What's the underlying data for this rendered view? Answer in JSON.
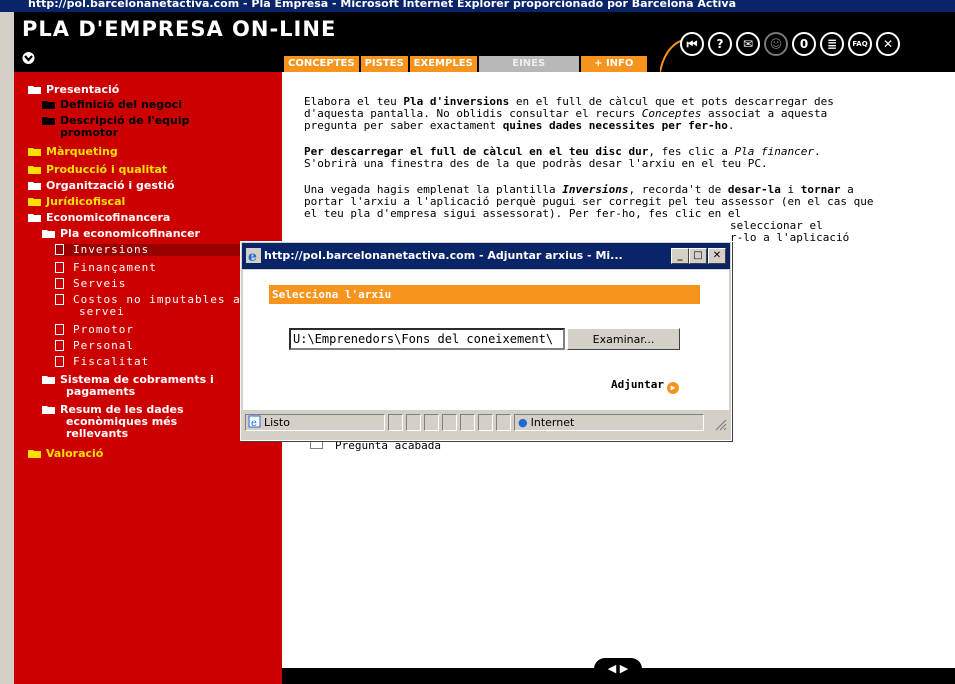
{
  "browser": {
    "title_bar": "http://pol.barcelonanetactiva.com - Pla Empresa - Microsoft Internet Explorer proporcionado por Barcelona Activa"
  },
  "app": {
    "title": "PLA D'EMPRESA ON-LINE"
  },
  "tabs": [
    "CONCEPTES",
    "PISTES",
    "EXEMPLES",
    "EINES",
    "+ INFO"
  ],
  "toolbar_icons": [
    {
      "name": "back-icon",
      "glyph": "⏮"
    },
    {
      "name": "help-icon",
      "glyph": "?"
    },
    {
      "name": "mail-icon",
      "glyph": "✉"
    },
    {
      "name": "user-icon",
      "glyph": "☺"
    },
    {
      "name": "clip-icon",
      "glyph": "0"
    },
    {
      "name": "notes-icon",
      "glyph": "≣"
    },
    {
      "name": "faq-icon",
      "glyph": "FAQ"
    },
    {
      "name": "close-icon",
      "glyph": "✕"
    }
  ],
  "sidebar": {
    "items": [
      {
        "label": "Presentació",
        "color": "#ffffff"
      },
      {
        "label": "Definició del negoci",
        "color": "#000000"
      },
      {
        "label": "Descripció de l'equip",
        "label2": "promotor",
        "color": "#000000"
      },
      {
        "label": "Màrqueting",
        "color": "#ffe000"
      },
      {
        "label": "Producció i qualitat",
        "color": "#ffe000"
      },
      {
        "label": "Organització i gestió",
        "color": "#ffffff"
      },
      {
        "label": "Jurídicofiscal",
        "color": "#ffe000"
      },
      {
        "label": "Economicofinancera",
        "color": "#ffffff"
      },
      {
        "label": "Pla economicofinancer",
        "color": "#ffffff"
      },
      {
        "label": "Inversions"
      },
      {
        "label": "Finançament"
      },
      {
        "label": "Serveis"
      },
      {
        "label": "Costos no imputables al",
        "label2": "servei"
      },
      {
        "label": "Promotor"
      },
      {
        "label": "Personal"
      },
      {
        "label": "Fiscalitat"
      },
      {
        "label": "Sistema de cobraments i",
        "label2": "pagaments",
        "color": "#ffffff"
      },
      {
        "label": "Resum de les dades",
        "label2": "econòmiques més",
        "label3": "rellevants",
        "color": "#ffffff"
      },
      {
        "label": "Valoració",
        "color": "#ffe000"
      }
    ]
  },
  "content": {
    "p1": {
      "a": "Elabora el teu ",
      "b": "Pla d'inversions",
      "c": " en el full de càlcul que et pots descarregar des d'aquesta pantalla. No oblidis consultar el recurs ",
      "d": "Conceptes",
      "e": " associat a aquesta pregunta per saber exactament ",
      "f": "quines dades necessites per fer-ho",
      "g": "."
    },
    "p2": {
      "a": "Per descarregar el full de càlcul en el teu disc dur",
      "b": ", fes clic a ",
      "c": "Pla financer",
      "d": ". S'obrirà una finestra des de la que podràs desar l'arxiu en el teu PC."
    },
    "p3": {
      "a": "Una vegada hagis emplenat la plantilla ",
      "b": "Inversions",
      "c": ", recorda't de ",
      "d": "desar-la",
      "e": " i ",
      "f": "tornar",
      "g": " a portar l'arxiu a l'aplicació perquè pugui ser corregit pel teu assessor (en el cas que el teu pla d'empresa sigui assessorat). Per fer-ho, fes clic en el",
      "h": "seleccionar el",
      "i": "r-lo a l'aplicació"
    },
    "checkbox_label": "Pregunta acabada"
  },
  "dialog": {
    "title": "http://pol.barcelonanetactiva.com - Adjuntar arxius - Mi...",
    "header": "Selecciona l'arxiu",
    "file_value": "U:\\Emprenedors\\Fons del coneixement\\",
    "browse_label": "Examinar...",
    "attach_label": "Adjuntar",
    "status_text": "Listo",
    "zone_text": "Internet"
  },
  "colors": {
    "sidebar": "#cc0000",
    "accent": "#f7941d",
    "header": "#000000",
    "titlebar": "#0a246a"
  }
}
